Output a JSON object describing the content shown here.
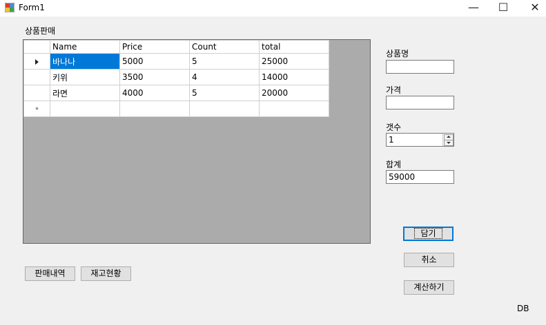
{
  "window": {
    "title": "Form1",
    "minimize": "—",
    "maximize": "☐",
    "close": "✕"
  },
  "group_label": "상품판매",
  "grid": {
    "columns": [
      "Name",
      "Price",
      "Count",
      "total"
    ],
    "rows": [
      {
        "name": "바나나",
        "price": "5000",
        "count": "5",
        "total": "25000"
      },
      {
        "name": "키위",
        "price": "3500",
        "count": "4",
        "total": "14000"
      },
      {
        "name": "라면",
        "price": "4000",
        "count": "5",
        "total": "20000"
      }
    ],
    "new_row_marker": "*"
  },
  "fields": {
    "product_name_label": "상품명",
    "product_name_value": "",
    "price_label": "가격",
    "price_value": "",
    "quantity_label": "갯수",
    "quantity_value": "1",
    "sum_label": "합계",
    "sum_value": "59000"
  },
  "buttons": {
    "add": "담기",
    "cancel": "취소",
    "calculate": "계산하기",
    "sales_history": "판매내역",
    "inventory": "재고현황"
  },
  "db_label": "DB",
  "colors": {
    "selection": "#0078d7",
    "grid_background": "#ababab",
    "form_background": "#f0f0f0"
  }
}
